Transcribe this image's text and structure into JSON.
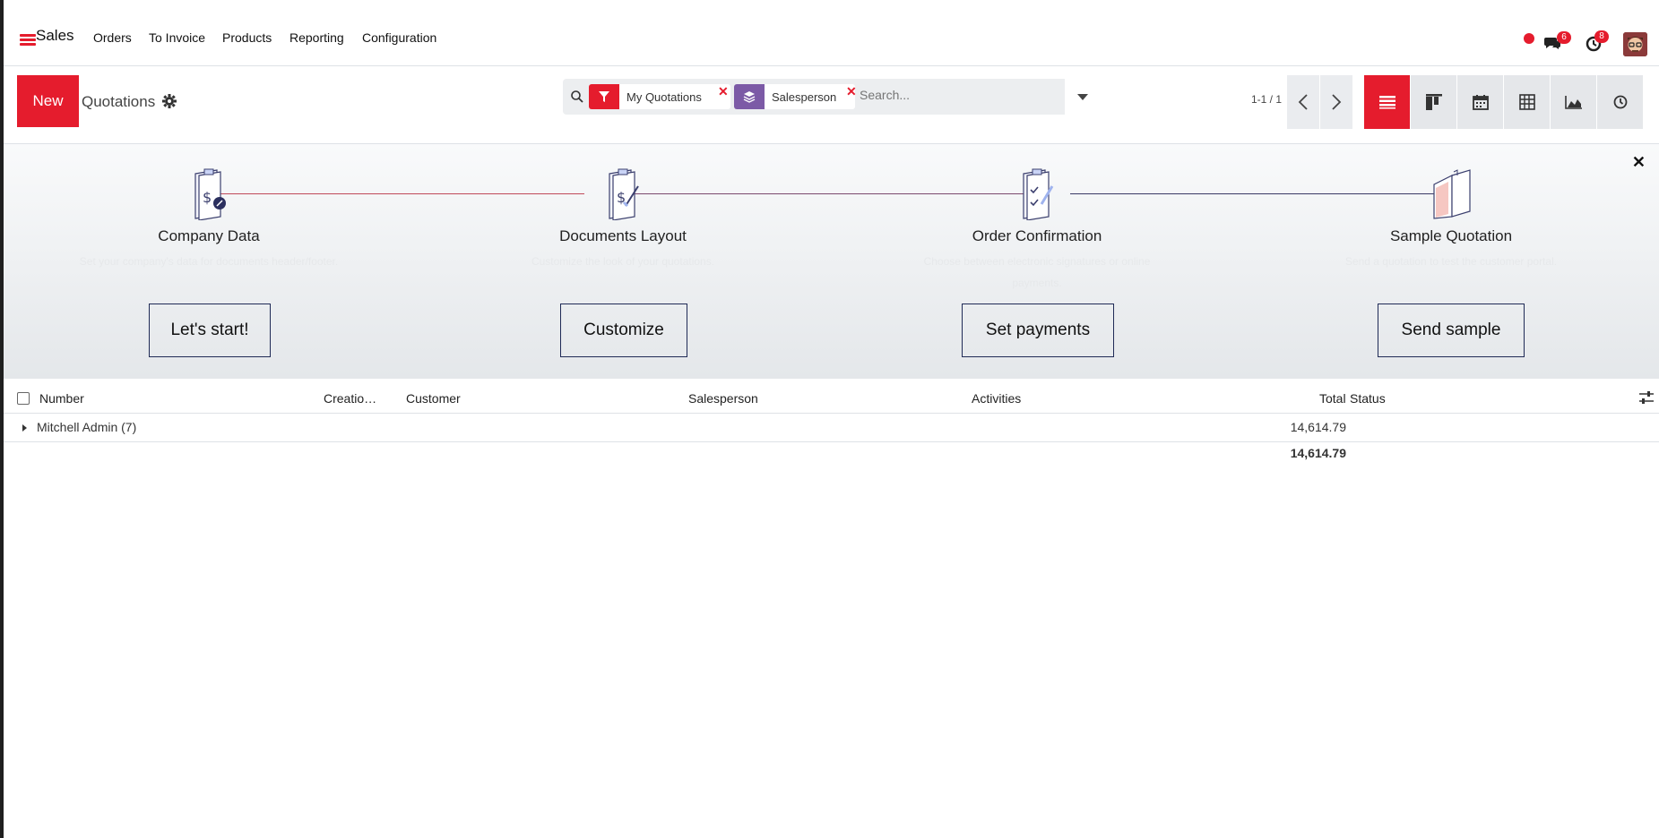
{
  "navbar": {
    "app_name": "Sales",
    "menu": [
      "Orders",
      "To Invoice",
      "Products",
      "Reporting",
      "Configuration"
    ],
    "messages_badge": "6",
    "activities_badge": "8",
    "accent_color": "#e51c2d"
  },
  "control_panel": {
    "new_label": "New",
    "title": "Quotations",
    "search": {
      "facets": [
        {
          "label": "My Quotations",
          "icon": "filter-icon",
          "color": "#e51c2d"
        },
        {
          "label": "Salesperson",
          "icon": "layers-icon",
          "color": "#7c5aa6"
        }
      ],
      "placeholder": "Search..."
    },
    "pager": "1-1 / 1",
    "views": [
      "list-view-icon",
      "kanban-view-icon",
      "calendar-view-icon",
      "pivot-view-icon",
      "graph-view-icon",
      "activity-view-icon"
    ]
  },
  "onboarding": {
    "steps": [
      {
        "title": "Company Data",
        "desc": "Set your company's data for documents header/footer.",
        "button": "Let's start!"
      },
      {
        "title": "Documents Layout",
        "desc": "Customize the look of your quotations.",
        "button": "Customize"
      },
      {
        "title": "Order Confirmation",
        "desc": "Choose between electronic signatures or online payments.",
        "button": "Set payments"
      },
      {
        "title": "Sample Quotation",
        "desc": "Send a quotation to test the customer portal.",
        "button": "Send sample"
      }
    ]
  },
  "table": {
    "columns": [
      "Number",
      "Creatio…",
      "Customer",
      "Salesperson",
      "Activities",
      "Total",
      "Status"
    ],
    "groups": [
      {
        "label": "Mitchell Admin (7)",
        "total": "14,614.79"
      }
    ],
    "grand_total": "14,614.79"
  }
}
